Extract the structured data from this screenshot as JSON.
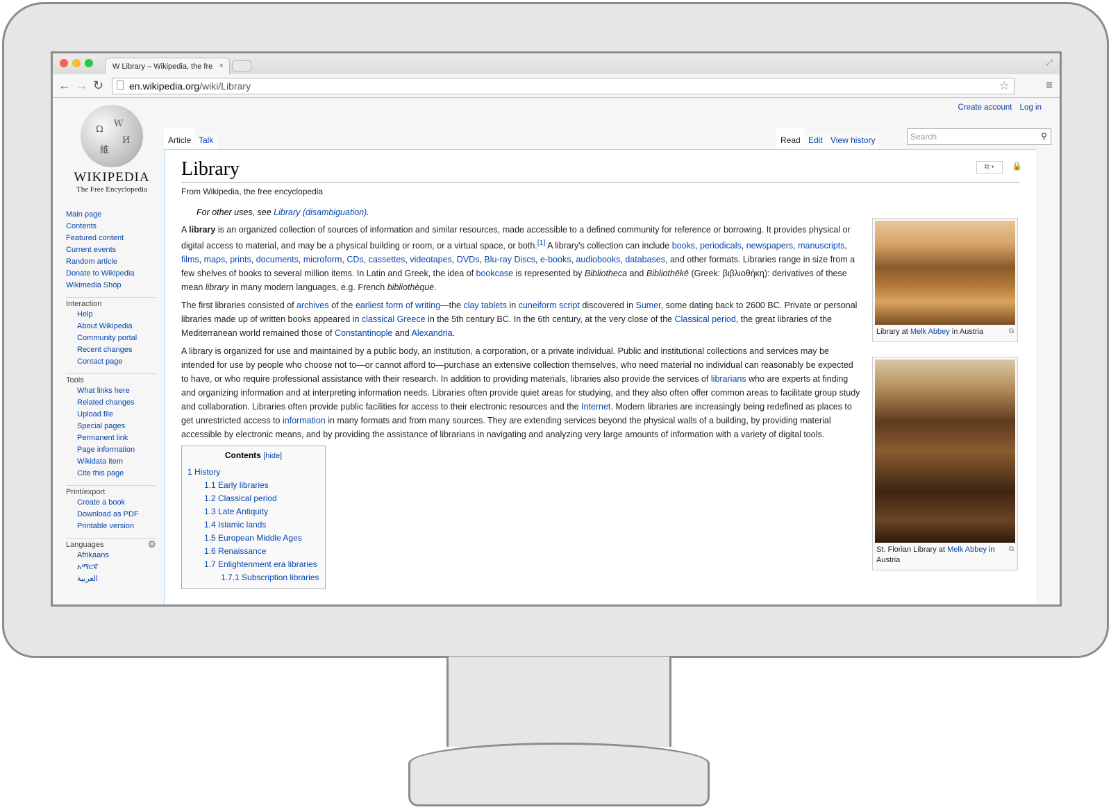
{
  "browser": {
    "tab_title": "W Library – Wikipedia, the fre",
    "tab_close": "×",
    "url_host": "en.wikipedia.org",
    "url_path": "/wiki/Library"
  },
  "logo": {
    "wordmark": "WIKIPEDIA",
    "tagline": "The Free Encyclopedia"
  },
  "personal": {
    "create_account": "Create account",
    "log_in": "Log in"
  },
  "tabs": {
    "article": "Article",
    "talk": "Talk",
    "read": "Read",
    "edit": "Edit",
    "view_history": "View history",
    "search_placeholder": "Search"
  },
  "sidebar": {
    "navigation": [
      "Main page",
      "Contents",
      "Featured content",
      "Current events",
      "Random article",
      "Donate to Wikipedia",
      "Wikimedia Shop"
    ],
    "interaction_heading": "Interaction",
    "interaction": [
      "Help",
      "About Wikipedia",
      "Community portal",
      "Recent changes",
      "Contact page"
    ],
    "tools_heading": "Tools",
    "tools": [
      "What links here",
      "Related changes",
      "Upload file",
      "Special pages",
      "Permanent link",
      "Page information",
      "Wikidata item",
      "Cite this page"
    ],
    "print_heading": "Print/export",
    "print": [
      "Create a book",
      "Download as PDF",
      "Printable version"
    ],
    "languages_heading": "Languages",
    "languages": [
      "Afrikaans",
      "አማርኛ",
      "العربية"
    ]
  },
  "article": {
    "title": "Library",
    "site_sub": "From Wikipedia, the free encyclopedia",
    "hatnote_prefix": "For other uses, see ",
    "hatnote_link": "Library (disambiguation)",
    "hatnote_suffix": "."
  },
  "toc": {
    "title": "Contents",
    "hide": "[hide]",
    "items": [
      {
        "level": 1,
        "text": "1 History"
      },
      {
        "level": 2,
        "text": "1.1 Early libraries"
      },
      {
        "level": 2,
        "text": "1.2 Classical period"
      },
      {
        "level": 2,
        "text": "1.3 Late Antiquity"
      },
      {
        "level": 2,
        "text": "1.4 Islamic lands"
      },
      {
        "level": 2,
        "text": "1.5 European Middle Ages"
      },
      {
        "level": 2,
        "text": "1.6 Renaissance"
      },
      {
        "level": 2,
        "text": "1.7 Enlightenment era libraries"
      },
      {
        "level": 3,
        "text": "1.7.1 Subscription libraries"
      }
    ]
  },
  "thumbs": {
    "first": {
      "caption_a": "Library at ",
      "link": "Melk Abbey",
      "caption_b": " in Austria"
    },
    "second": {
      "caption_a": "St. Florian Library at ",
      "link": "Melk Abbey",
      "caption_b": " in Austria"
    }
  }
}
